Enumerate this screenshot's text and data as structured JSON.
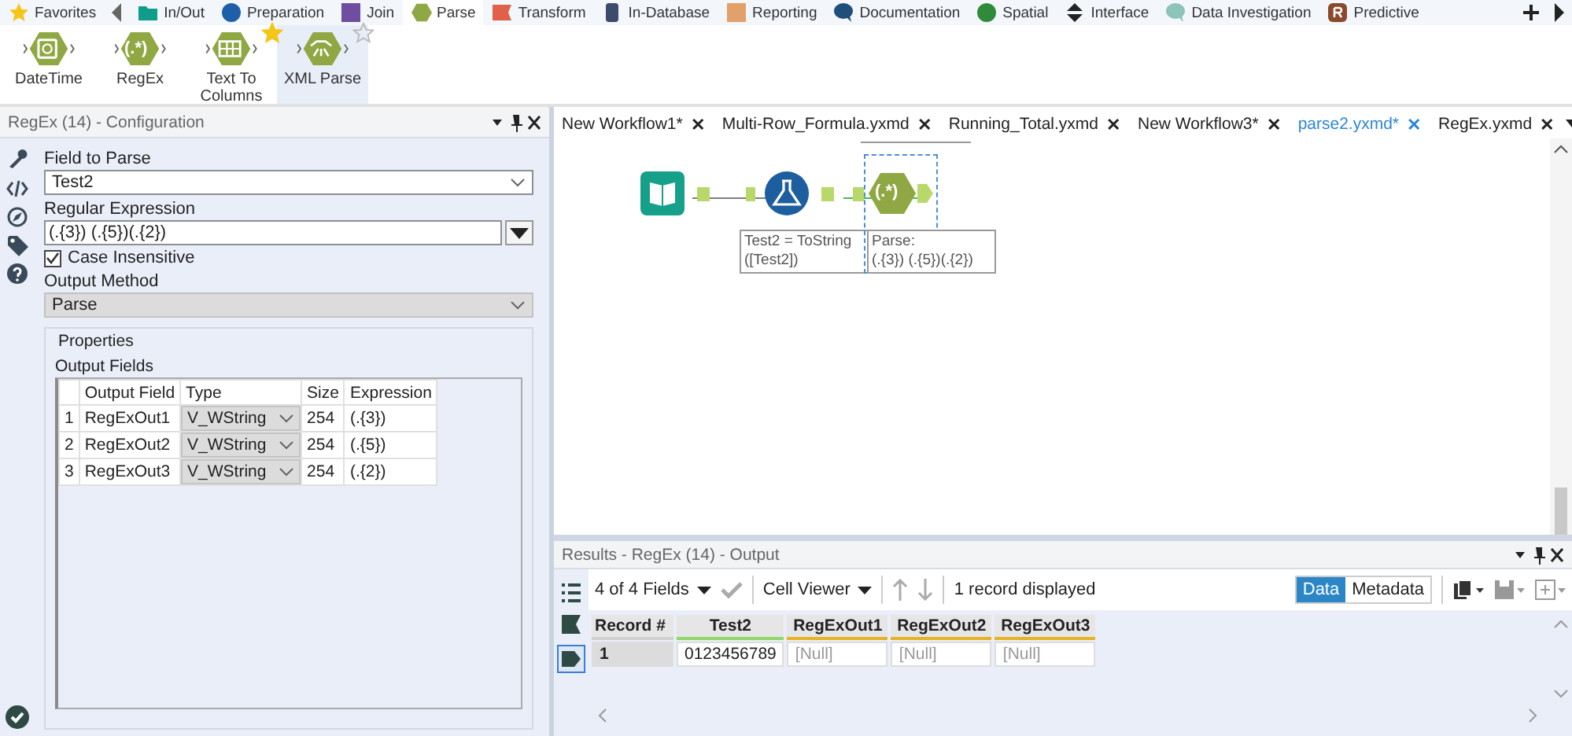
{
  "categories": [
    {
      "label": "Favorites",
      "kind": "star",
      "color": "#f5c518",
      "selected": false
    },
    {
      "label": "In/Out",
      "kind": "folder",
      "color": "#0f9d8a",
      "selected": false
    },
    {
      "label": "Preparation",
      "kind": "circle",
      "color": "#1f5fa8",
      "selected": false
    },
    {
      "label": "Join",
      "kind": "square",
      "color": "#6f4ea1",
      "selected": false
    },
    {
      "label": "Parse",
      "kind": "hexagon",
      "color": "#8fa843",
      "selected": true
    },
    {
      "label": "Transform",
      "kind": "flag",
      "color": "#e0604a",
      "selected": false
    },
    {
      "label": "In-Database",
      "kind": "cylinder",
      "color": "#3c4a6b",
      "selected": false
    },
    {
      "label": "Reporting",
      "kind": "square",
      "color": "#e3a06a",
      "selected": false
    },
    {
      "label": "Documentation",
      "kind": "bubble",
      "color": "#1f4e79",
      "selected": false
    },
    {
      "label": "Spatial",
      "kind": "circle",
      "color": "#2e8b3a",
      "selected": false
    },
    {
      "label": "Interface",
      "kind": "updown",
      "color": "#222222",
      "selected": false
    },
    {
      "label": "Data Investigation",
      "kind": "bubble",
      "color": "#8ec3b9",
      "selected": false
    },
    {
      "label": "Predictive",
      "kind": "r",
      "color": "#8b4a2b",
      "selected": false
    }
  ],
  "tools": [
    {
      "label": "DateTime",
      "kind": "clock",
      "favorite": false,
      "selected": false
    },
    {
      "label": "RegEx",
      "kind": "text",
      "glyph": "(.*)",
      "favorite": false,
      "selected": false
    },
    {
      "label": "Text To Columns",
      "kind": "table",
      "favorite": true,
      "selected": false
    },
    {
      "label": "XML Parse",
      "kind": "xml",
      "favorite": false,
      "selected": true
    }
  ],
  "config": {
    "title": "RegEx (14) - Configuration",
    "field_to_parse": {
      "label": "Field to Parse",
      "value": "Test2"
    },
    "regular_expression": {
      "label": "Regular Expression",
      "value": "(.{3}) (.{5})(.{2})"
    },
    "case_insensitive": {
      "label": "Case Insensitive",
      "checked": true
    },
    "output_method": {
      "label": "Output Method",
      "value": "Parse"
    },
    "properties": {
      "label": "Properties",
      "grid_label": "Output Fields",
      "columns": [
        "Output Field",
        "Type",
        "Size",
        "Expression"
      ],
      "rows": [
        {
          "number": "1",
          "field": "RegExOut1",
          "type": "V_WString",
          "size": "254",
          "expression": "(.{3})"
        },
        {
          "number": "2",
          "field": "RegExOut2",
          "type": "V_WString",
          "size": "254",
          "expression": "(.{5})"
        },
        {
          "number": "3",
          "field": "RegExOut3",
          "type": "V_WString",
          "size": "254",
          "expression": "(.{2})"
        }
      ]
    }
  },
  "workflow_tabs": [
    {
      "label": "New Workflow1*",
      "close": "✕",
      "selected": false
    },
    {
      "label": "Multi-Row_Formula.yxmd",
      "close": "✕",
      "selected": false
    },
    {
      "label": "Running_Total.yxmd",
      "close": "✕",
      "selected": false
    },
    {
      "label": "New Workflow3*",
      "close": "✕",
      "selected": false
    },
    {
      "label": "parse2.yxmd*",
      "close": "✕",
      "selected": true
    },
    {
      "label": "RegEx.yxmd",
      "close": "✕",
      "selected": false
    }
  ],
  "canvas_nodes": [
    {
      "kind": "input",
      "selected": false
    },
    {
      "kind": "formula",
      "selected": false,
      "annotation": [
        "Test2 = ToString",
        "([Test2])"
      ]
    },
    {
      "kind": "regex",
      "selected": true,
      "glyph": "(.*)",
      "annotation": [
        "Parse:",
        "(.{3}) (.{5})(.{2})"
      ]
    }
  ],
  "results": {
    "title": "Results - RegEx (14) - Output",
    "fields_selector": "4 of 4 Fields",
    "viewer": "Cell Viewer",
    "record_count": "1 record displayed",
    "view_toggle": [
      {
        "label": "Data",
        "selected": true
      },
      {
        "label": "Metadata",
        "selected": false
      }
    ],
    "columns": [
      {
        "label": "Record #",
        "color": "#d0d0d0"
      },
      {
        "label": "Test2",
        "color": "#8fd86a"
      },
      {
        "label": "RegExOut1",
        "color": "#e6b325"
      },
      {
        "label": "RegExOut2",
        "color": "#e6b325"
      },
      {
        "label": "RegExOut3",
        "color": "#e6b325"
      }
    ],
    "rows": [
      [
        "1",
        "0123456789",
        "[Null]",
        "[Null]",
        "[Null]"
      ]
    ]
  }
}
